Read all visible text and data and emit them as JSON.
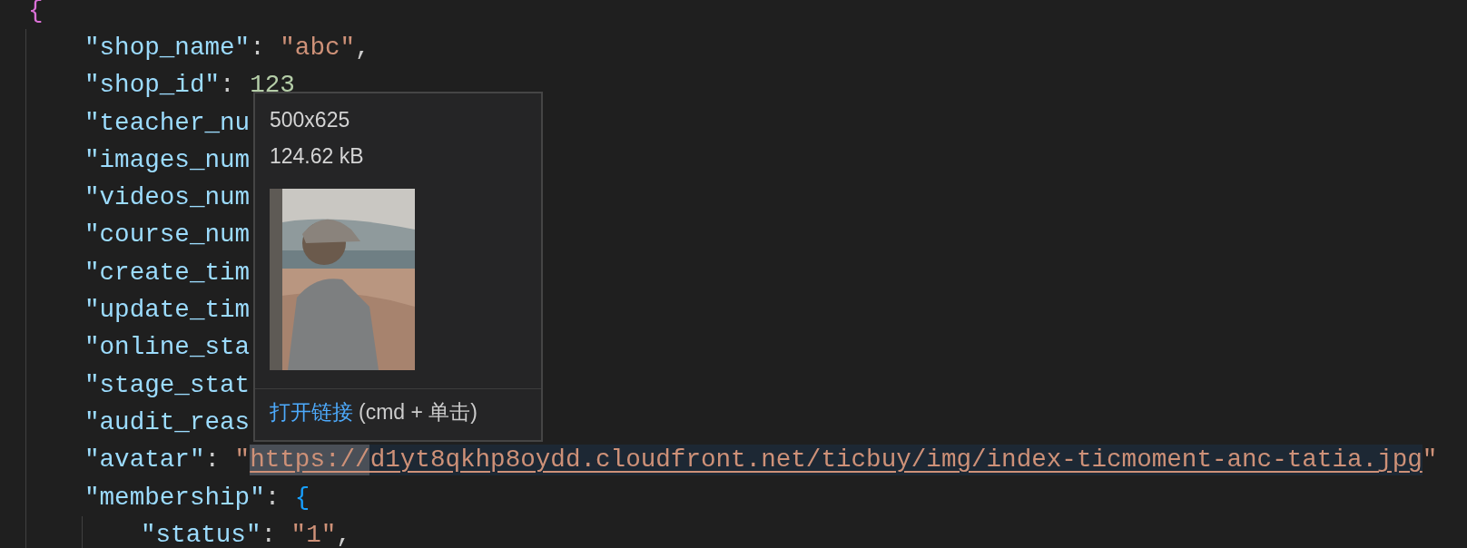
{
  "editor": {
    "lines": [
      {
        "tokens": [
          {
            "kind": "brace",
            "text": "{"
          }
        ],
        "children": [
          {
            "tokens": [
              {
                "kind": "key",
                "text": "\"shop_name\""
              },
              {
                "kind": "punct",
                "text": ": "
              },
              {
                "kind": "string",
                "text": "\"abc\""
              },
              {
                "kind": "punct",
                "text": ","
              }
            ]
          },
          {
            "tokens": [
              {
                "kind": "key",
                "text": "\"shop_id\""
              },
              {
                "kind": "punct",
                "text": ": "
              },
              {
                "kind": "number",
                "text": "123"
              }
            ]
          },
          {
            "tokens": [
              {
                "kind": "key",
                "text": "\"teacher_nu"
              }
            ]
          },
          {
            "tokens": [
              {
                "kind": "key",
                "text": "\"images_num"
              }
            ]
          },
          {
            "tokens": [
              {
                "kind": "key",
                "text": "\"videos_num"
              }
            ]
          },
          {
            "tokens": [
              {
                "kind": "key",
                "text": "\"course_num"
              }
            ]
          },
          {
            "tokens": [
              {
                "kind": "key",
                "text": "\"create_tim"
              }
            ]
          },
          {
            "tokens": [
              {
                "kind": "key",
                "text": "\"update_tim"
              }
            ]
          },
          {
            "tokens": [
              {
                "kind": "key",
                "text": "\"online_sta"
              }
            ]
          },
          {
            "tokens": [
              {
                "kind": "key",
                "text": "\"stage_stat"
              }
            ]
          },
          {
            "tokens": [
              {
                "kind": "key",
                "text": "\"audit_reas"
              }
            ]
          },
          {
            "tokens": [
              {
                "kind": "key",
                "text": "\"avatar\""
              },
              {
                "kind": "punct",
                "text": ": "
              },
              {
                "kind": "string",
                "text": "\""
              },
              {
                "kind": "link",
                "text": "https://d1yt8qkhp8oydd.cloudfront.net/ticbuy/img/index-ticmoment-anc-tatia.jpg"
              },
              {
                "kind": "string",
                "text": "\""
              }
            ]
          },
          {
            "tokens": [
              {
                "kind": "key",
                "text": "\"membership\""
              },
              {
                "kind": "punct",
                "text": ": "
              },
              {
                "kind": "brace2",
                "text": "{"
              }
            ],
            "children": [
              {
                "tokens": [
                  {
                    "kind": "key",
                    "text": "\"status\""
                  },
                  {
                    "kind": "punct",
                    "text": ": "
                  },
                  {
                    "kind": "string",
                    "text": "\"1\""
                  },
                  {
                    "kind": "punct",
                    "text": ","
                  }
                ]
              }
            ]
          }
        ]
      }
    ]
  },
  "hover": {
    "dimensions": "500x625",
    "size": "124.62 kB",
    "link": {
      "action": "打开链接",
      "hint": "(cmd + 单击)"
    }
  }
}
